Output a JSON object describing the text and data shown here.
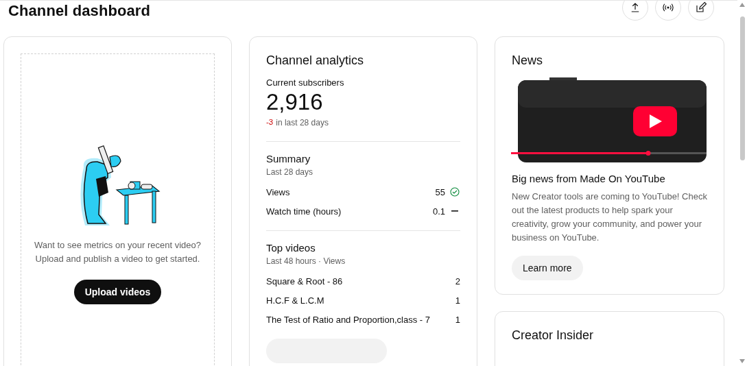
{
  "page": {
    "title": "Channel dashboard"
  },
  "header_actions": [
    {
      "kind": "upload"
    },
    {
      "kind": "live"
    },
    {
      "kind": "edit"
    }
  ],
  "video_card": {
    "message": "Want to see metrics on your recent video? Upload and publish a video to get started.",
    "button": "Upload videos"
  },
  "analytics": {
    "title": "Channel analytics",
    "subscribers_label": "Current subscribers",
    "subscribers": "2,916",
    "change": "-3",
    "change_label": "in last 28 days",
    "summary": {
      "title": "Summary",
      "period": "Last 28 days",
      "rows": [
        {
          "label": "Views",
          "value": "55",
          "kind": "check"
        },
        {
          "label": "Watch time (hours)",
          "value": "0.1",
          "kind": "dash"
        }
      ]
    },
    "top_videos": {
      "title": "Top videos",
      "period": "Last 48 hours · Views",
      "rows": [
        {
          "title": "Square & Root - 86",
          "views": "2"
        },
        {
          "title": "H.C.F & L.C.M",
          "views": "1"
        },
        {
          "title": "The Test of Ratio and Proportion,class - 7",
          "views": "1"
        }
      ]
    }
  },
  "news": {
    "title": "News",
    "headline": "Big news from Made On YouTube",
    "body": "New Creator tools are coming to YouTube! Check out the latest products to help spark your creativity, grow your community, and power your business on YouTube.",
    "button": "Learn more"
  },
  "creator_insider": {
    "title": "Creator Insider"
  }
}
